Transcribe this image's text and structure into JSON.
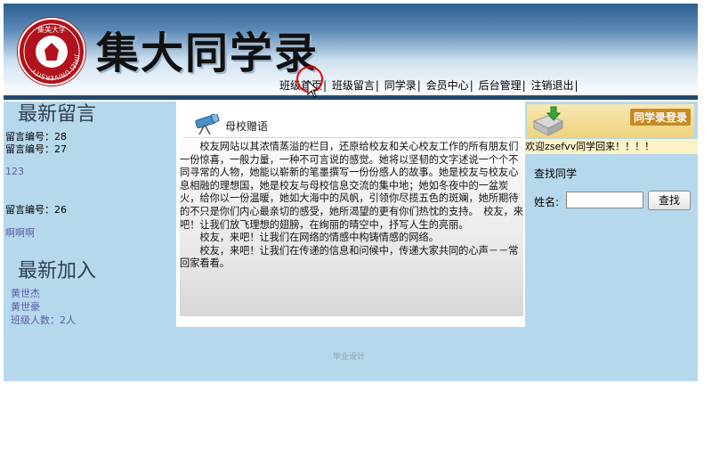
{
  "header": {
    "site_title": "集大同学录",
    "logo_text": "JIMEI UNIVERSITY",
    "logo_top_text": "集美大学",
    "colors": {
      "header_dark": "#2c5d8f",
      "bar": "#23486d",
      "logo_red": "#b1121b"
    }
  },
  "nav": {
    "items": [
      {
        "label": "班级首页"
      },
      {
        "label": "班级留言"
      },
      {
        "label": "同学录"
      },
      {
        "label": "会员中心"
      },
      {
        "label": "后台管理"
      },
      {
        "label": "注销退出"
      }
    ],
    "separator": "|"
  },
  "left": {
    "latest_messages_title": "最新留言",
    "messages": [
      {
        "text": "留言编号：28"
      },
      {
        "text": "留言编号：27"
      },
      {
        "text": "123"
      },
      {
        "text": "留言编号：26"
      },
      {
        "text": "啊啊啊"
      }
    ],
    "latest_join_title": "最新加入",
    "members": [
      "黄世杰",
      "黄世豪"
    ],
    "class_count": "班级人数：2人"
  },
  "center": {
    "panel_title": "母校赠语",
    "paragraphs": [
      "　　校友网站以其浓情蒸溢的栏目，还原给校友和关心校友工作的所有朋友们一份惊喜，一般力量，一种不可言说的感觉。她将以坚韧的文字述说一个个不同寻常的人物，她能以崭新的笔墨撰写一份份感人的故事。她是校友与校友心息相融的理想国，她是校友与母校信息交流的集中地；她如冬夜中的一盆炭火，给你以一份温暖，她如大海中的风帆，引领你尽揽五色的斑斓，她所期待的不只是你们内心最亲切的感受，她所渴望的更有你们热忱的支持。　校友，来吧！让我们放飞理想的翅膀，在绚丽的晴空中，抒写人生的亮丽。",
      "　　校友，来吧！让我们在网络的情感中构铸情感的网络。",
      "　　校友，来吧！让我们在传递的信息和问候中，传递大家共同的心声－－常回家看看。"
    ]
  },
  "right": {
    "login_tag": "同学录登录",
    "welcome": "欢迎zsefvv同学回来！！！！",
    "search_caption": "查找同学",
    "name_label": "姓名:",
    "name_value": "",
    "search_button": "查找"
  },
  "footer": {
    "text": "毕业设计"
  }
}
